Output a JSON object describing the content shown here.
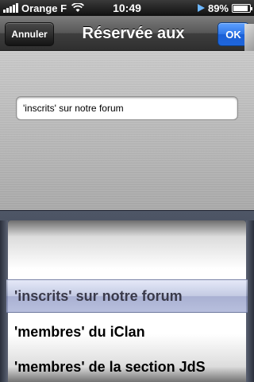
{
  "status_bar": {
    "carrier": "Orange F",
    "time": "10:49",
    "battery_percent": "89%",
    "battery_level": 0.89,
    "signal_bars": 5,
    "icons": [
      "signal-bars-icon",
      "wifi-icon",
      "location-arrow-icon",
      "battery-icon"
    ]
  },
  "nav_bar": {
    "cancel_label": "Annuler",
    "title": "Réservée aux",
    "ok_label": "OK",
    "colors": {
      "ok_button": "#2f77e8",
      "cancel_button": "#2a2a2a"
    }
  },
  "field": {
    "value": "'inscrits' sur notre forum"
  },
  "picker": {
    "options": [
      "",
      "'inscrits' sur notre forum",
      "'membres' du iClan",
      "'membres' de la section JdS"
    ],
    "selected": "'inscrits' sur notre forum"
  }
}
